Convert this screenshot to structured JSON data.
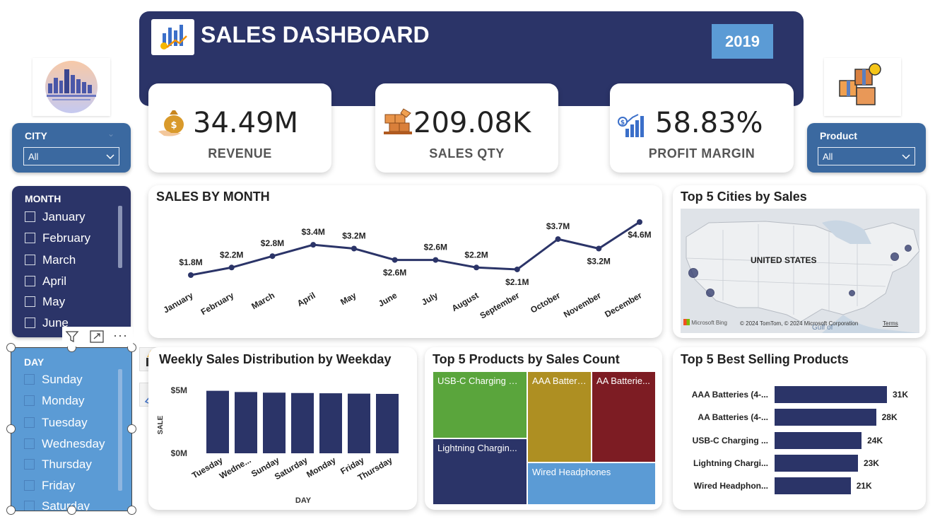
{
  "header": {
    "title": "SALES DASHBOARD",
    "year": "2019",
    "colors": {
      "header_bg": "#2b3468",
      "year_bg": "#5b9bd5"
    }
  },
  "icons": {
    "header": "bar-chart-growth-icon",
    "city_logo": "city-skyline-icon",
    "product_logo": "product-boxes-icon",
    "revenue": "money-bag-icon",
    "qty": "boxes-pallet-icon",
    "profit": "profit-growth-icon"
  },
  "kpis": [
    {
      "value": "34.49M",
      "label": "REVENUE"
    },
    {
      "value": "209.08K",
      "label": "SALES QTY"
    },
    {
      "value": "58.83%",
      "label": "PROFIT MARGIN"
    }
  ],
  "filters": {
    "city": {
      "title": "CITY",
      "selected": "All"
    },
    "product": {
      "title": "Product",
      "selected": "All"
    },
    "month": {
      "title": "MONTH",
      "items": [
        "January",
        "February",
        "March",
        "April",
        "May",
        "June"
      ]
    },
    "day": {
      "title": "DAY",
      "items": [
        "Sunday",
        "Monday",
        "Tuesday",
        "Wednesday",
        "Thursday",
        "Friday",
        "Saturday"
      ]
    }
  },
  "map": {
    "title": "Top 5 Cities by Sales",
    "country_label": "UNITED STATES",
    "gulf_label": "Gulf of",
    "attribution": "© 2024 TomTom, © 2024 Microsoft Corporation",
    "terms": "Terms",
    "bing": "Microsoft Bing"
  },
  "chart_data": [
    {
      "type": "line",
      "title": "SALES BY MONTH",
      "categories": [
        "January",
        "February",
        "March",
        "April",
        "May",
        "June",
        "July",
        "August",
        "September",
        "October",
        "November",
        "December"
      ],
      "values": [
        1.8,
        2.2,
        2.8,
        3.4,
        3.2,
        2.6,
        2.6,
        2.2,
        2.1,
        3.7,
        3.2,
        4.6
      ],
      "labels": [
        "$1.8M",
        "$2.2M",
        "$2.8M",
        "$3.4M",
        "$3.2M",
        "$2.6M",
        "$2.6M",
        "$2.2M",
        "$2.1M",
        "$3.7M",
        "$3.2M",
        "$4.6M"
      ],
      "color": "#2b3468"
    },
    {
      "type": "bar",
      "title": "Weekly Sales Distribution by Weekday",
      "categories": [
        "Tuesday",
        "Wednesday",
        "Sunday",
        "Saturday",
        "Monday",
        "Friday",
        "Thursday"
      ],
      "tick_labels": [
        "Tuesday",
        "Wedne...",
        "Sunday",
        "Saturday",
        "Monday",
        "Friday",
        "Thursday"
      ],
      "values": [
        5.05,
        4.95,
        4.9,
        4.87,
        4.85,
        4.82,
        4.8
      ],
      "xlabel": "DAY",
      "ylabel": "SALE",
      "yticks": [
        "$5M",
        "$0M"
      ],
      "ylim": [
        0,
        5.6
      ],
      "color": "#2b3468"
    },
    {
      "type": "treemap",
      "title": "Top 5 Products by Sales Count",
      "items": [
        {
          "label": "USB-C Charging C...",
          "color": "#5aa53c"
        },
        {
          "label": "Lightning Chargin...",
          "color": "#2b3468"
        },
        {
          "label": "AAA Batteri...",
          "color": "#ae8f22"
        },
        {
          "label": "AA Batterie...",
          "color": "#7d1c23"
        },
        {
          "label": "Wired Headphones",
          "color": "#5b9bd5"
        }
      ]
    },
    {
      "type": "bar",
      "orientation": "horizontal",
      "title": "Top 5 Best Selling Products",
      "categories": [
        "AAA Batteries (4-...",
        "AA Batteries (4-...",
        "USB-C Charging ...",
        "Lightning Chargi...",
        "Wired Headphon..."
      ],
      "values": [
        31,
        28,
        24,
        23,
        21
      ],
      "labels": [
        "31K",
        "28K",
        "24K",
        "23K",
        "21K"
      ],
      "color": "#2b3468"
    }
  ]
}
